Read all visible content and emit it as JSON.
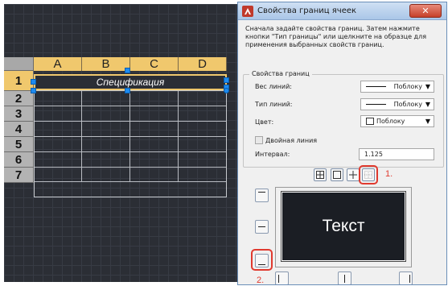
{
  "table": {
    "columns": [
      "A",
      "B",
      "C",
      "D"
    ],
    "rows": [
      "1",
      "2",
      "3",
      "4",
      "5",
      "6",
      "7"
    ],
    "title_cell": "Спецификация"
  },
  "dialog": {
    "title": "Свойства границ ячеек",
    "close_glyph": "✕",
    "intro": "Сначала задайте свойства границ. Затем нажмите кнопки \"Тип границы\" или щелкните на образце для применения выбранных свойств границ.",
    "group_title": "Свойства границ",
    "lineweight_label": "Вес линий:",
    "lineweight_value": "Поблоку",
    "linetype_label": "Тип линий:",
    "linetype_value": "Поблоку",
    "color_label": "Цвет:",
    "color_value": "Поблоку",
    "double_line_label": "Двойная линия",
    "double_line_checked": false,
    "interval_label": "Интервал:",
    "interval_value": "1.125",
    "preview_text": "Текст",
    "callout_1": "1.",
    "callout_2": "2."
  },
  "colors": {
    "column_header": "#f0c86d",
    "row_header": "#b3b3b3",
    "grip": "#1d8bf0",
    "callout": "#e03a2f",
    "workspace": "#2b2e35"
  }
}
